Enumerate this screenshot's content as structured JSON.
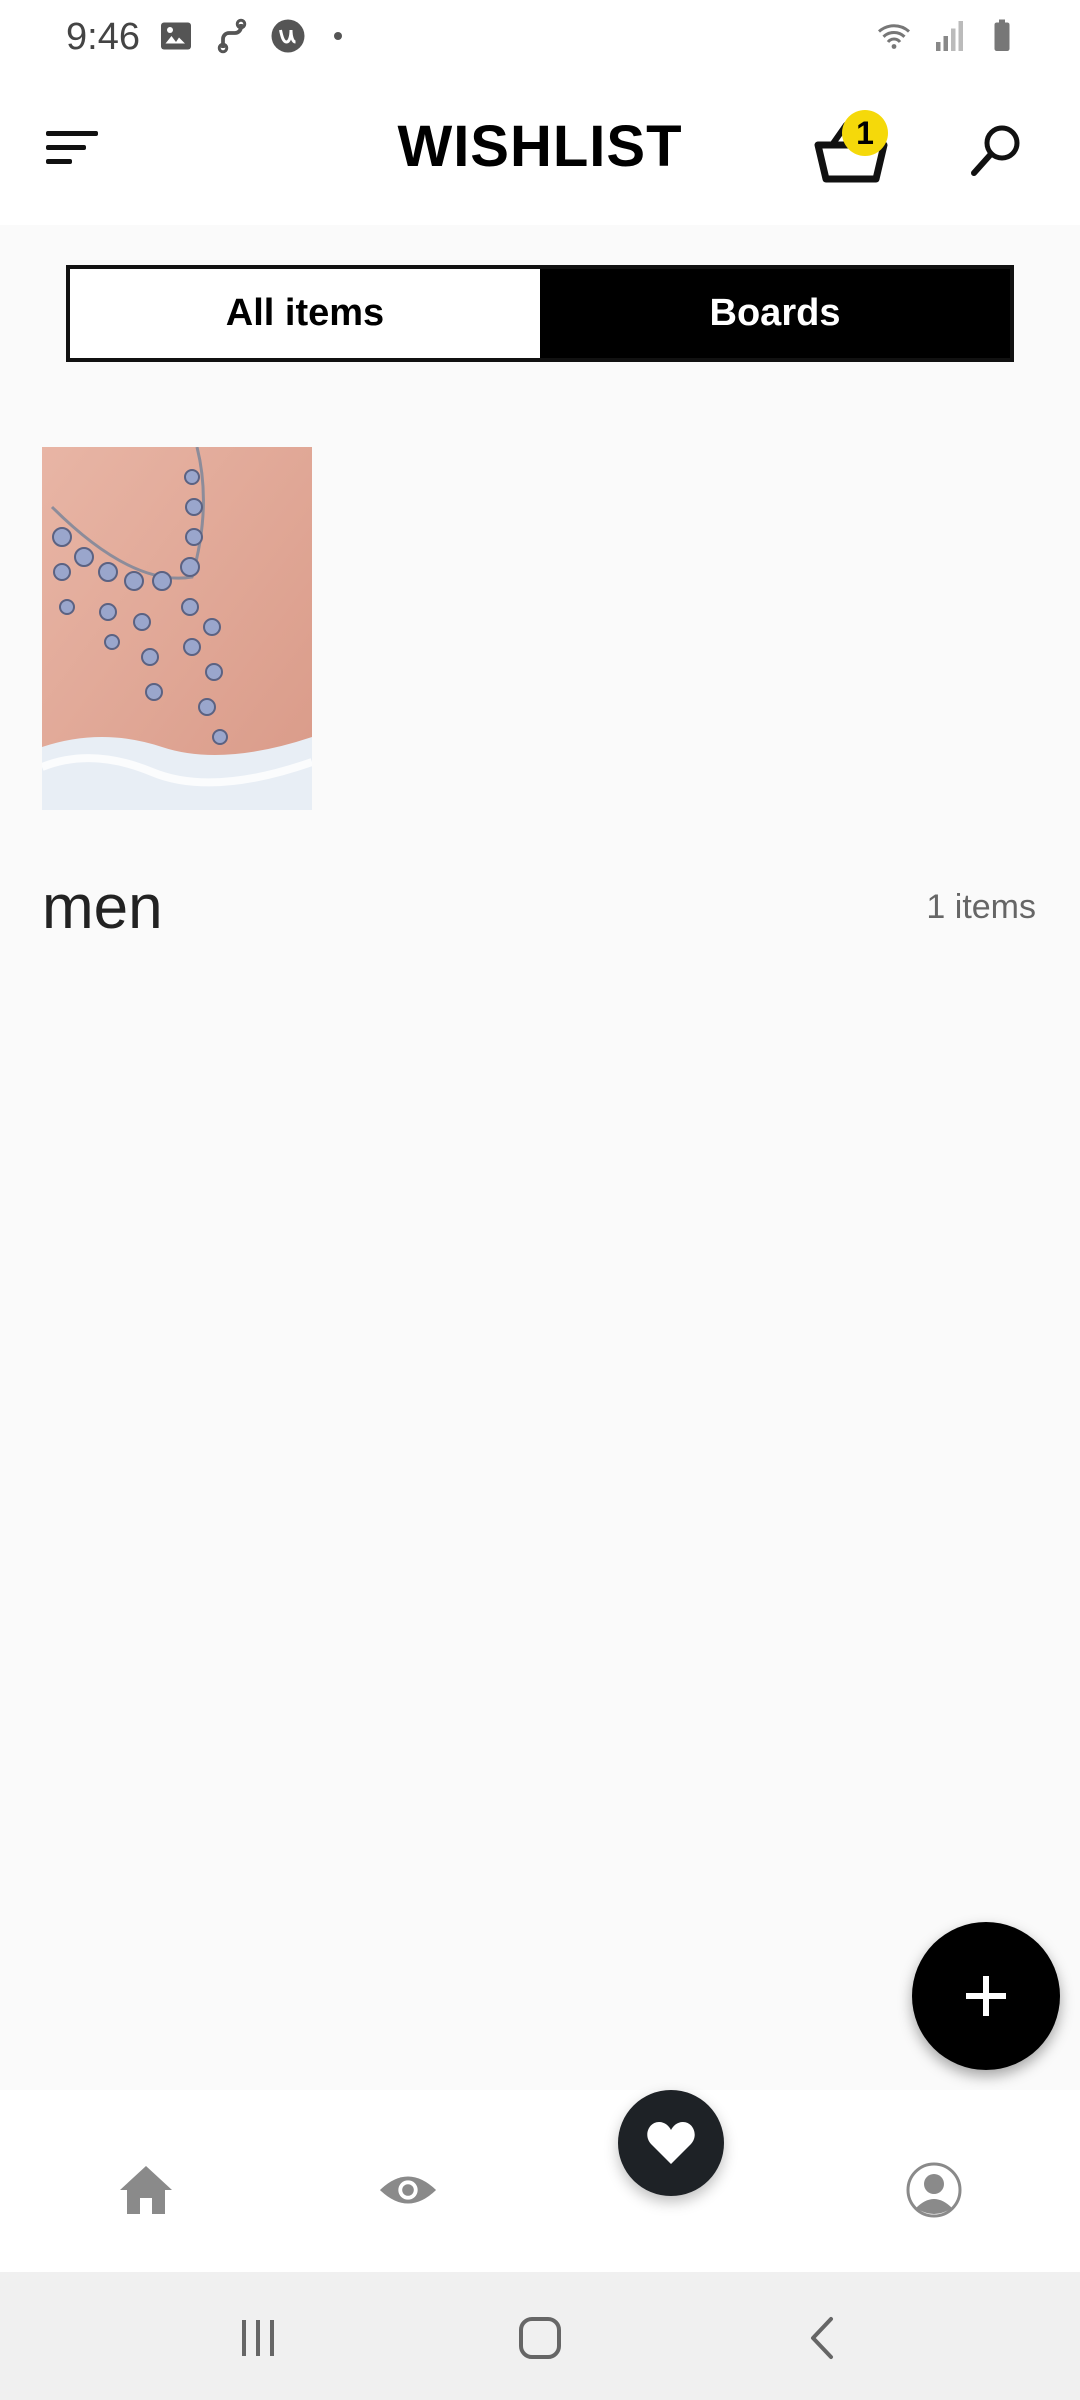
{
  "status_bar": {
    "time": "9:46",
    "left_icons": [
      "image-icon",
      "route-icon",
      "app-u-icon",
      "dot-icon"
    ],
    "right_icons": [
      "wifi-icon",
      "signal-icon",
      "battery-icon"
    ]
  },
  "header": {
    "title": "WISHLIST",
    "cart_badge": "1",
    "icons": [
      "menu-icon",
      "basket-icon",
      "search-icon"
    ]
  },
  "tabs": [
    {
      "label": "All items",
      "active": true
    },
    {
      "label": "Boards",
      "active": false
    }
  ],
  "boards": [
    {
      "name": "men",
      "count_label": "1 items",
      "thumbnail": "necklace-image"
    }
  ],
  "fab": {
    "icon": "plus-icon"
  },
  "bottom_nav": {
    "items": [
      "home-icon",
      "eye-icon",
      "heart-icon",
      "profile-icon"
    ],
    "active": "heart-icon"
  },
  "system_nav": [
    "recents-icon",
    "home-button-icon",
    "back-icon"
  ],
  "colors": {
    "badge": "#f5d90a",
    "primary": "#000000",
    "nav_inactive": "#8a8a8a",
    "background": "#fafafa"
  }
}
